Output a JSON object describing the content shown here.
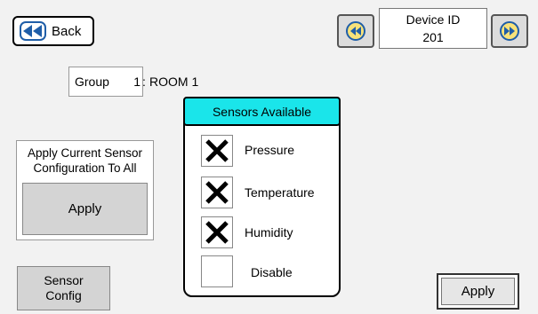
{
  "header": {
    "back_label": "Back",
    "device_id_label": "Device ID",
    "device_id_value": "201"
  },
  "group": {
    "label": "Group",
    "number": "1",
    "separator": ":",
    "name": "ROOM 1"
  },
  "apply_all": {
    "text_line1": "Apply Current Sensor",
    "text_line2": "Configuration To All",
    "button_label": "Apply"
  },
  "sensor_config": {
    "line1": "Sensor",
    "line2": "Config"
  },
  "sensors_panel": {
    "title": "Sensors Available",
    "items": [
      {
        "label": "Pressure",
        "checked": true
      },
      {
        "label": "Temperature",
        "checked": true
      },
      {
        "label": "Humidity",
        "checked": true
      },
      {
        "label": "Disable",
        "checked": false
      }
    ]
  },
  "bottom": {
    "apply_label": "Apply"
  },
  "colors": {
    "panel_header": "#1ae5ea",
    "button_gray": "#d4d4d4",
    "background": "#f2f2f2"
  }
}
